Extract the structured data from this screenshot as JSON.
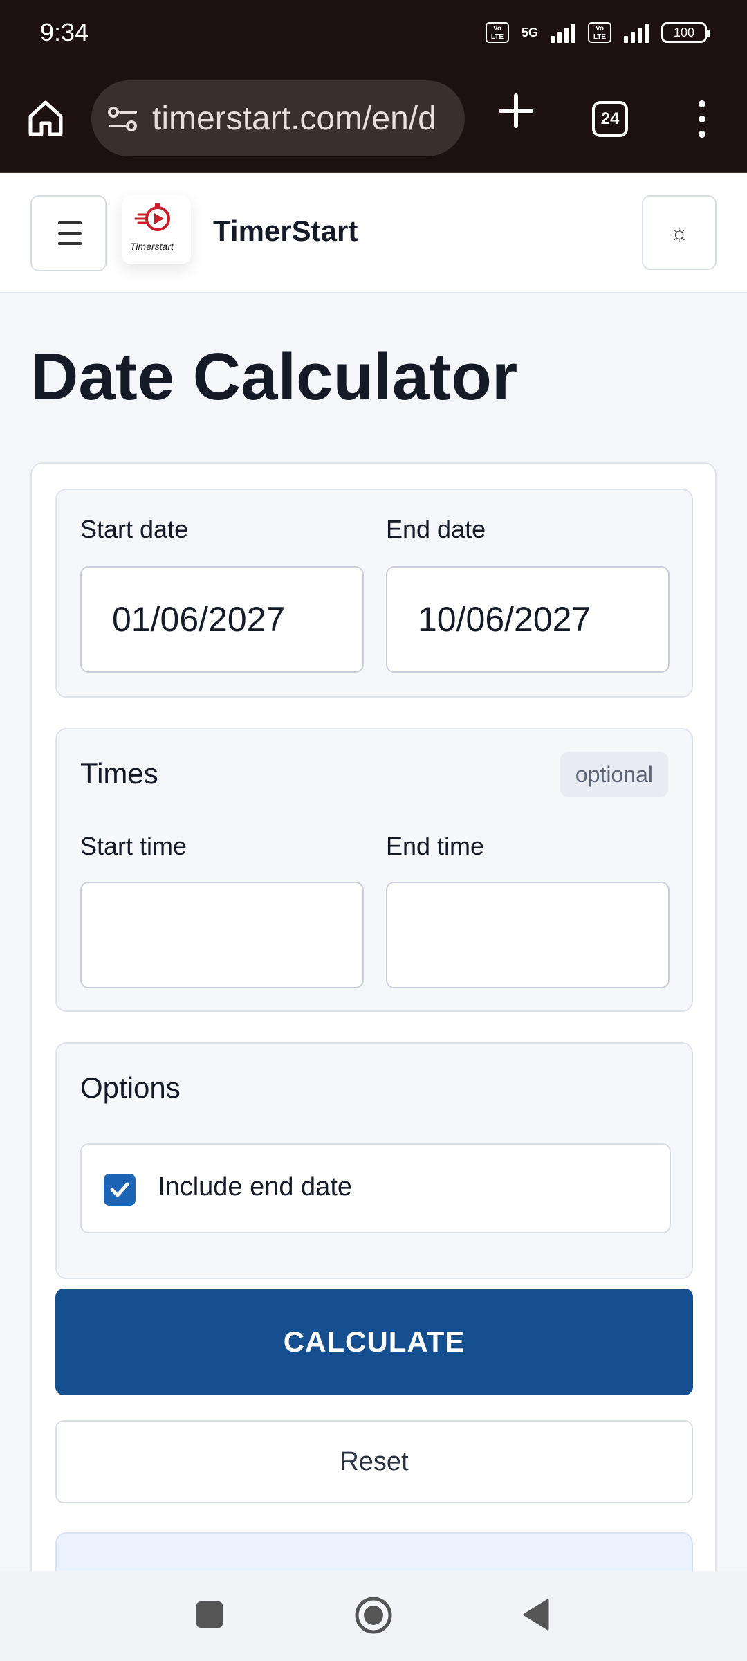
{
  "status_bar": {
    "time": "9:34",
    "network": "5G",
    "volte_label": "Vo LTE",
    "battery": "100"
  },
  "browser": {
    "url": "timerstart.com/en/d",
    "tab_count": "24",
    "icons": [
      "home-icon",
      "site-settings-icon",
      "new-tab-icon",
      "tabs-icon",
      "menu-icon"
    ]
  },
  "header": {
    "logo_text": "Timerstart",
    "site_title": "TimerStart",
    "theme_icon": "☼"
  },
  "page": {
    "title": "Date Calculator"
  },
  "dates": {
    "start_label": "Start date",
    "start_value": "01/06/2027",
    "end_label": "End date",
    "end_value": "10/06/2027"
  },
  "times": {
    "heading": "Times",
    "badge": "optional",
    "start_label": "Start time",
    "start_value": "",
    "end_label": "End time",
    "end_value": ""
  },
  "options": {
    "heading": "Options",
    "include_end_label": "Include end date",
    "include_end_checked": true
  },
  "actions": {
    "calculate_label": "CALCULATE",
    "reset_label": "Reset"
  },
  "colors": {
    "primary": "#154f8f",
    "checkbox": "#1d64b5",
    "browser_chrome": "#1c1110",
    "page_background": "#f4f6f9"
  }
}
